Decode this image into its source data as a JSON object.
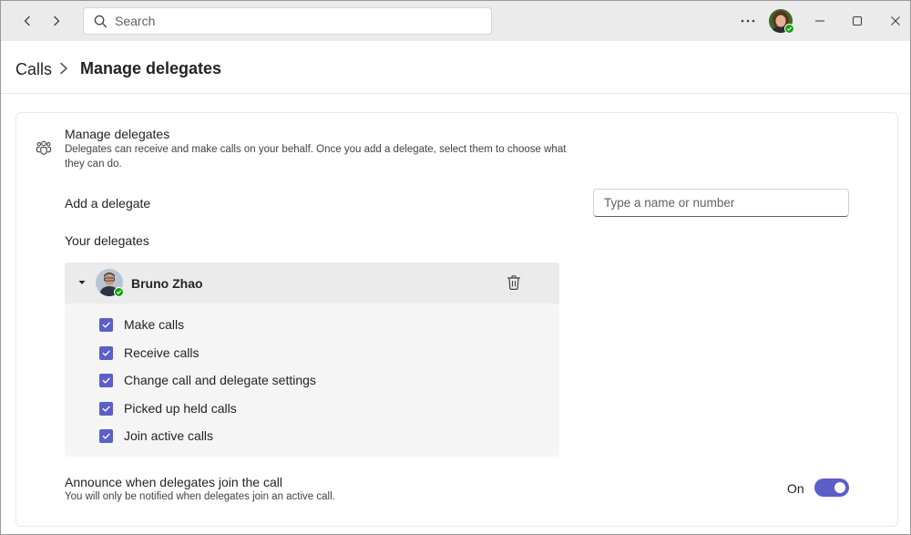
{
  "search": {
    "placeholder": "Search"
  },
  "breadcrumb": {
    "parent": "Calls",
    "current": "Manage delegates"
  },
  "section": {
    "title": "Manage delegates",
    "description": "Delegates can receive and make calls on your behalf. Once you add a delegate, select them to choose what they can do."
  },
  "add_delegate": {
    "label": "Add a delegate",
    "placeholder": "Type a name or number"
  },
  "your_delegates": {
    "label": "Your delegates",
    "delegate": {
      "name": "Bruno Zhao",
      "expanded": true,
      "permissions": [
        {
          "label": "Make calls",
          "checked": true
        },
        {
          "label": "Receive calls",
          "checked": true
        },
        {
          "label": "Change call and delegate settings",
          "checked": true
        },
        {
          "label": "Picked up held calls",
          "checked": true
        },
        {
          "label": "Join active calls",
          "checked": true
        }
      ]
    }
  },
  "announce": {
    "title": "Announce when delegates join the call",
    "description": "You will only be notified when delegates join an active call.",
    "state_label": "On",
    "enabled": true
  },
  "colors": {
    "accent": "#5b5fc7",
    "presence_available": "#13a10e"
  },
  "icons": {
    "back": "chevron-left-icon",
    "forward": "chevron-right-icon",
    "search": "search-icon",
    "more": "more-horizontal-icon",
    "minimize": "minimize-icon",
    "maximize": "maximize-icon",
    "close": "close-icon",
    "section": "people-team-icon",
    "delete": "delete-icon"
  }
}
